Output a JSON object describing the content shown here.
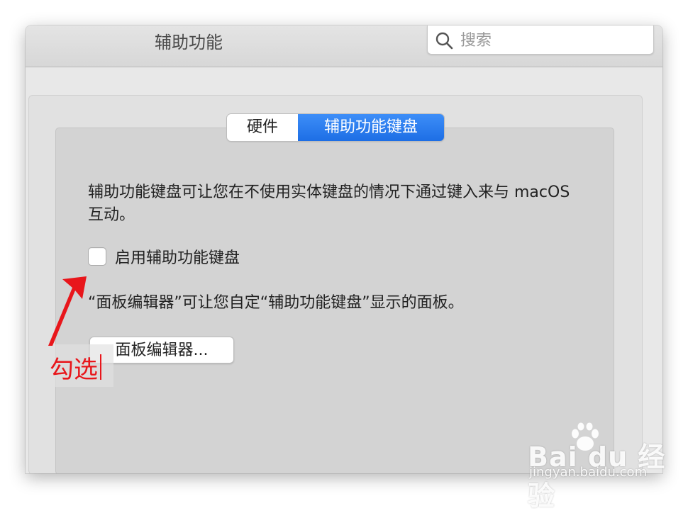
{
  "window": {
    "title": "辅助功能"
  },
  "search": {
    "placeholder": "搜索"
  },
  "tabs": [
    {
      "label": "硬件",
      "selected": false
    },
    {
      "label": "辅助功能键盘",
      "selected": true
    }
  ],
  "content": {
    "description": "辅助功能键盘可让您在不使用实体键盘的情况下通过键入来与 macOS 互动。",
    "checkbox_label": "启用辅助功能键盘",
    "checkbox_checked": false,
    "panel_editor_description": "“面板编辑器”可让您自定“辅助功能键盘”显示的面板。",
    "panel_editor_button": "面板编辑器..."
  },
  "annotation": {
    "label": "勾选",
    "color": "#e8161b"
  },
  "watermark": {
    "brand": "Bai  du 经验",
    "url": "jingyan.baidu.com"
  },
  "colors": {
    "accent": "#1d6ee5"
  }
}
